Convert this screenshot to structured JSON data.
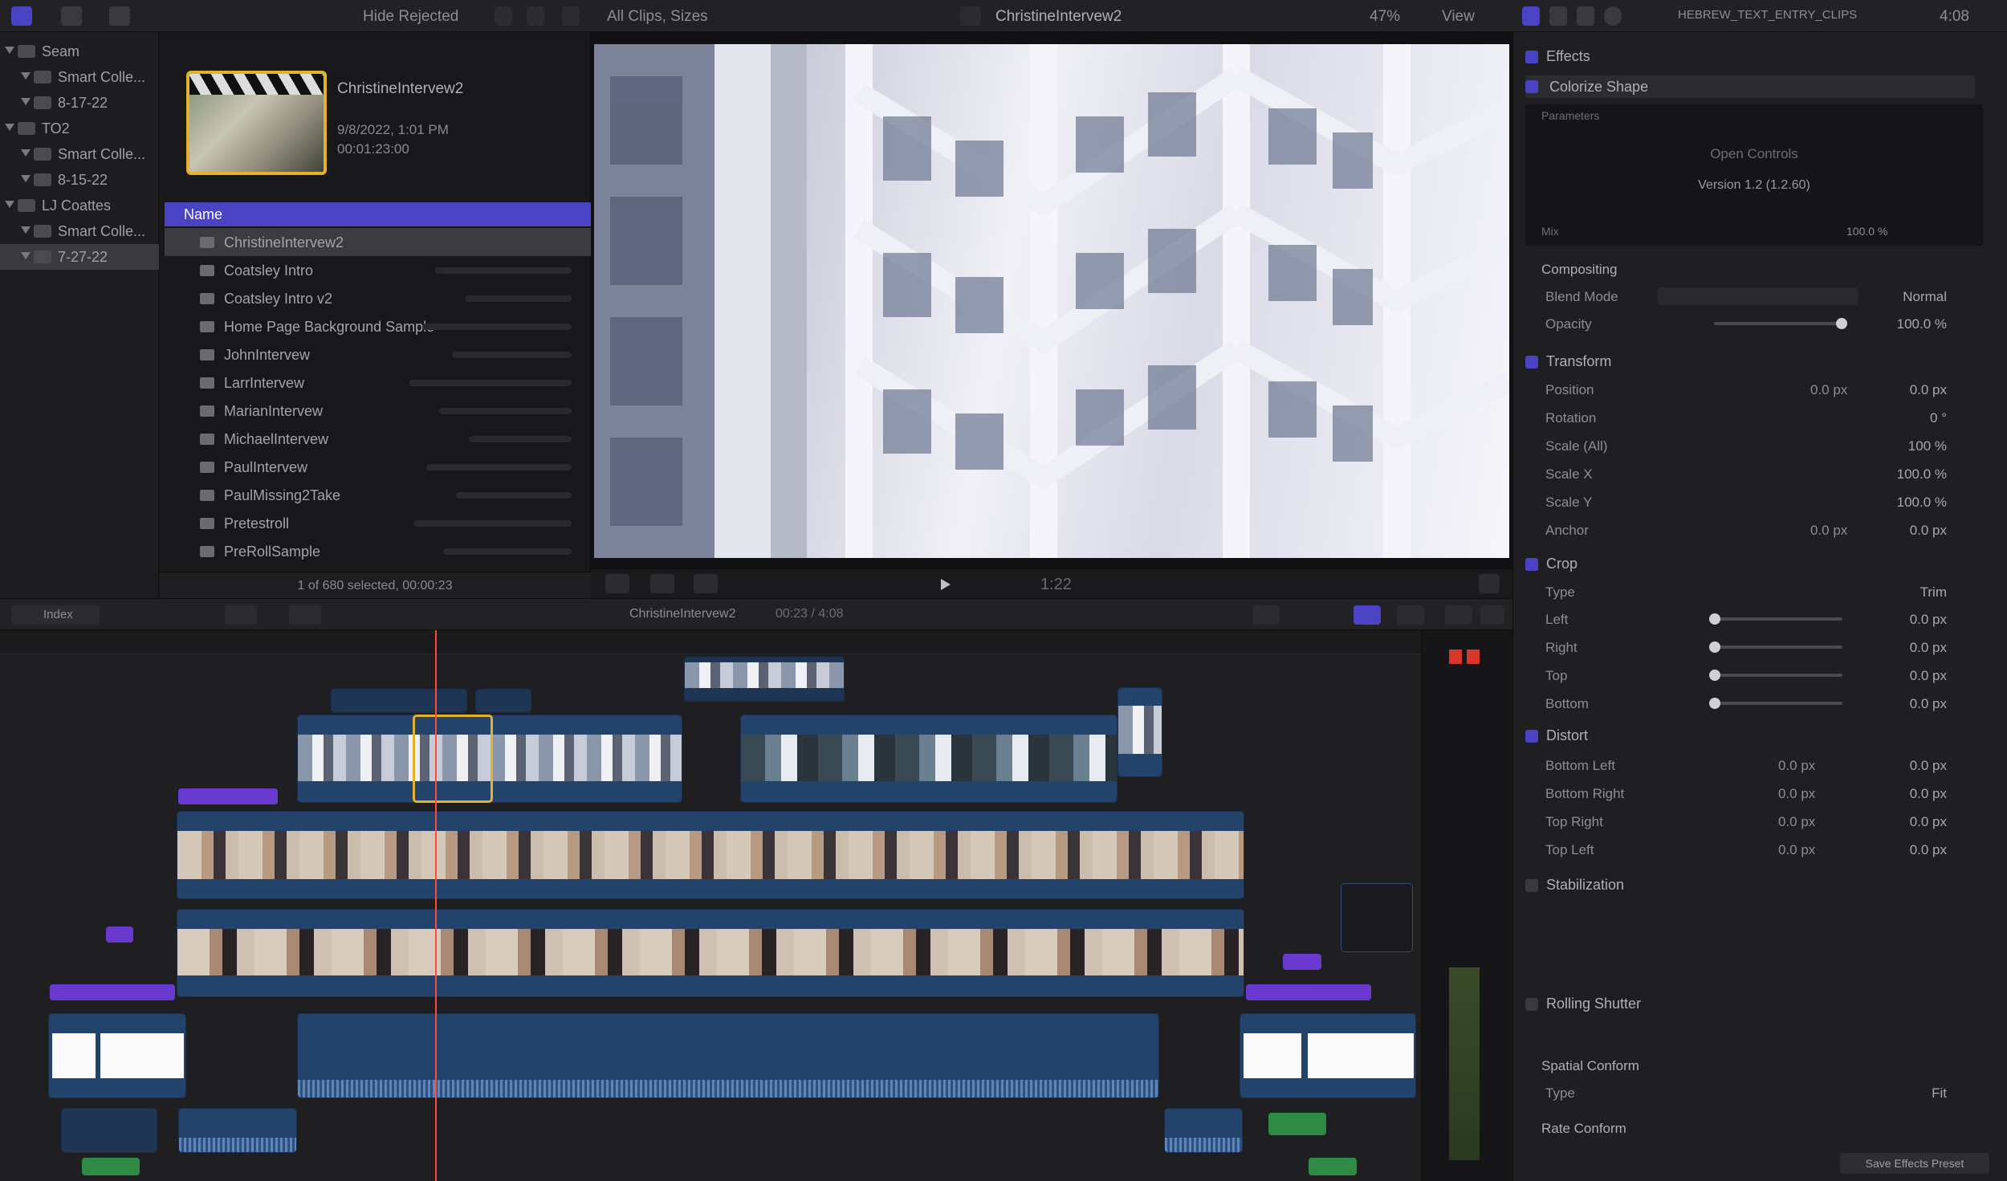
{
  "toolbar": {
    "keywords_label": "Hide Rejected",
    "clip_count": "All Clips, Sizes",
    "clip_name": "ChristineIntervew2",
    "zoom": "47%",
    "view_label": "View",
    "inspector_title": "HEBREW_TEXT_ENTRY_CLIPS",
    "duration": "4:08"
  },
  "libraries": {
    "items": [
      {
        "label": "Seam",
        "indent": 0
      },
      {
        "label": "Smart Colle...",
        "indent": 1
      },
      {
        "label": "8-17-22",
        "indent": 1
      },
      {
        "label": "TO2",
        "indent": 0
      },
      {
        "label": "Smart Colle...",
        "indent": 1
      },
      {
        "label": "8-15-22",
        "indent": 1
      },
      {
        "label": "LJ Coattes",
        "indent": 0
      },
      {
        "label": "Smart Colle...",
        "indent": 1
      },
      {
        "label": "7-27-22",
        "indent": 1
      }
    ]
  },
  "browser": {
    "clip_title": "ChristineIntervew2",
    "clip_meta_1": "9/8/2022, 1:01 PM",
    "clip_meta_2": "00:01:23:00",
    "list_header": "Name",
    "items": [
      "ChristineIntervew2",
      "Coatsley Intro",
      "Coatsley Intro v2",
      "Home Page Background Sample",
      "JohnIntervew",
      "LarrIntervew",
      "MarianIntervew",
      "MichaelIntervew",
      "PaulIntervew",
      "PaulMissing2Take",
      "Pretestroll",
      "PreRollSample"
    ],
    "status": "1 of 680 selected, 00:00:23"
  },
  "viewer": {
    "timecode": "1:22"
  },
  "timeline": {
    "index_label": "Index",
    "project_name": "ChristineIntervew2",
    "project_time": "00:23 / 4:08"
  },
  "inspector": {
    "effects_label": "Effects",
    "effect_name": "Colorize Shape",
    "preset_label": "Parameters",
    "open_label": "Open Controls",
    "version_label": "Version 1.2 (1.2.60)",
    "mix_label": "Mix",
    "mix_value": "100.0 %",
    "compositing": "Compositing",
    "blend_mode": "Blend Mode",
    "blend_value": "Normal",
    "opacity": "Opacity",
    "opacity_value": "100.0 %",
    "transform": "Transform",
    "transform_rows": [
      {
        "name": "Position",
        "x": "0.0 px",
        "y": "0.0 px"
      },
      {
        "name": "Rotation",
        "x": "",
        "y": "0 °"
      },
      {
        "name": "Scale (All)",
        "x": "",
        "y": "100 %"
      },
      {
        "name": "Scale X",
        "x": "",
        "y": "100.0 %"
      },
      {
        "name": "Scale Y",
        "x": "",
        "y": "100.0 %"
      },
      {
        "name": "Anchor",
        "x": "0.0 px",
        "y": "0.0 px"
      }
    ],
    "crop": "Crop",
    "crop_type": "Type",
    "crop_type_value": "Trim",
    "crop_rows": [
      {
        "name": "Left",
        "value": "0.0 px"
      },
      {
        "name": "Right",
        "value": "0.0 px"
      },
      {
        "name": "Top",
        "value": "0.0 px"
      },
      {
        "name": "Bottom",
        "value": "0.0 px"
      }
    ],
    "distort": "Distort",
    "distort_rows": [
      {
        "name": "Bottom Left",
        "x": "0.0 px",
        "y": "0.0 px"
      },
      {
        "name": "Bottom Right",
        "x": "0.0 px",
        "y": "0.0 px"
      },
      {
        "name": "Top Right",
        "x": "0.0 px",
        "y": "0.0 px"
      },
      {
        "name": "Top Left",
        "x": "0.0 px",
        "y": "0.0 px"
      }
    ],
    "stabilization": "Stabilization",
    "rolling_shutter": "Rolling Shutter",
    "spatial_conform": "Spatial Conform",
    "spatial_type": "Type",
    "spatial_type_value": "Fit",
    "rate_conform": "Rate Conform",
    "save_preset": "Save Effects Preset"
  },
  "colors": {
    "accent": "#4a43c4",
    "selection": "#e2b12e",
    "clip_blue": "#23436a",
    "title_purple": "#6a3ad0",
    "audio_green": "#2e8a44",
    "playhead": "#ff4a3a"
  }
}
